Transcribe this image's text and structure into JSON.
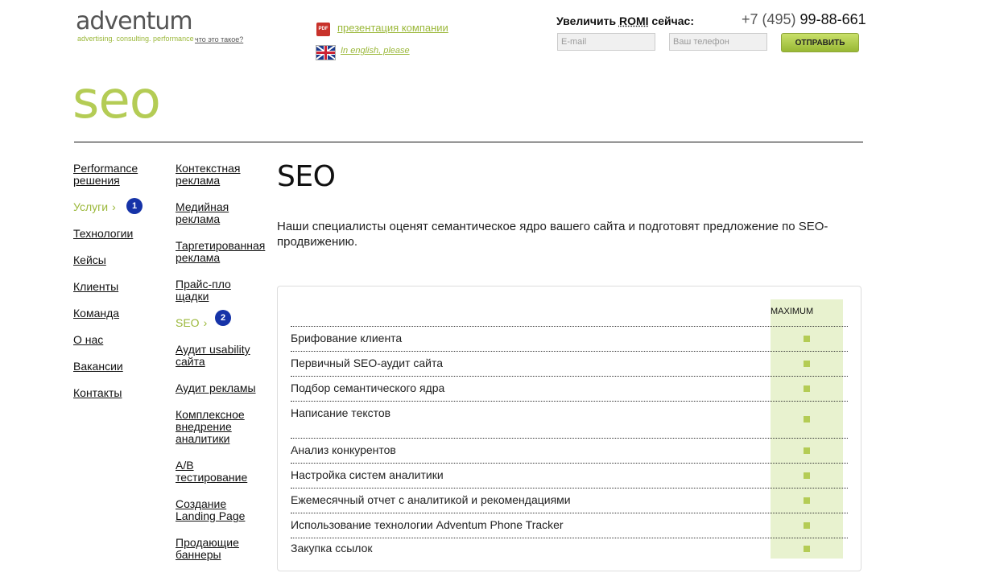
{
  "header": {
    "logo": "adventum",
    "tagline": "advertising. consulting. performance",
    "whatis": "что это такое?",
    "presentation_link": "презентация компании",
    "english_link": "In english, please",
    "pdf_label": "PDF",
    "romi_text_pre": "Увеличить ",
    "romi_word": "ROMI",
    "romi_text_post": " сейчас:",
    "phone_code": "+7 (495)",
    "phone_number": " 99-88-661",
    "email_placeholder": "E-mail",
    "phone_placeholder": "Ваш телефон",
    "send_label": "ОТПРАВИТЬ"
  },
  "page_big_title": "seo",
  "nav_main": [
    {
      "label": "Performance решения",
      "active": false
    },
    {
      "label": "Услуги",
      "active": true,
      "badge": "1"
    },
    {
      "label": "Технологии",
      "active": false
    },
    {
      "label": "Кейсы",
      "active": false
    },
    {
      "label": "Клиенты",
      "active": false
    },
    {
      "label": "Команда",
      "active": false
    },
    {
      "label": "О нас",
      "active": false
    },
    {
      "label": "Вакансии",
      "active": false
    },
    {
      "label": "Контакты",
      "active": false
    }
  ],
  "nav_sub": [
    {
      "label": "Контекстная реклама",
      "active": false
    },
    {
      "label": "Медийная реклама",
      "active": false
    },
    {
      "label": "Таргетированная реклама",
      "active": false
    },
    {
      "label": "Прайс-площадки",
      "active": false
    },
    {
      "label": "SEO",
      "active": true,
      "badge": "2"
    },
    {
      "label": "Аудит usability сайта",
      "active": false
    },
    {
      "label": "Аудит рекламы",
      "active": false
    },
    {
      "label": "Комплексное внедрение аналитики",
      "active": false
    },
    {
      "label": "A/B тестирование",
      "active": false
    },
    {
      "label": "Создание Landing Page",
      "active": false
    },
    {
      "label": "Продающие баннеры",
      "active": false
    }
  ],
  "main": {
    "title": "SEO",
    "intro": "Наши специалисты оценят семантическое ядро вашего сайта и подготовят предложение по SEO-продвижению.",
    "column_header": "MAXIMUM",
    "rows": [
      {
        "label": "Брифование клиента",
        "included": true
      },
      {
        "label": "Первичный SEO-аудит сайта",
        "included": true
      },
      {
        "label": "Подбор семантического ядра",
        "included": true
      },
      {
        "label": "Написание текстов",
        "included": true
      },
      {
        "label": "Анализ конкурентов",
        "included": true
      },
      {
        "label": "Настройка систем аналитики",
        "included": true
      },
      {
        "label": "Ежемесячный отчет с аналитикой и рекомендациями",
        "included": true
      },
      {
        "label": "Использование технологии Adventum Phone Tracker",
        "included": true
      },
      {
        "label": "Закупка ссылок",
        "included": true
      }
    ]
  },
  "colors": {
    "accent_green": "#9bb83a",
    "light_green": "#e8f2cf",
    "badge_blue": "#1633a8"
  }
}
